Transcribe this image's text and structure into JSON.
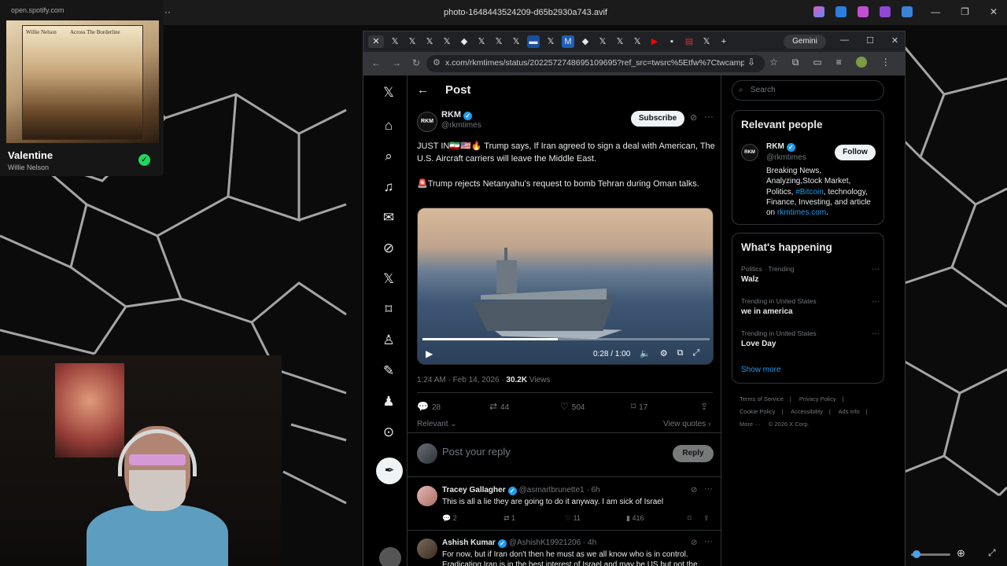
{
  "photo_viewer": {
    "title": "photo-1648443524209-d65b2930a743.avif",
    "controls": [
      "—",
      "❐",
      "✕"
    ]
  },
  "spotify": {
    "url": "open.spotify.com",
    "album_artist": "Willie Nelson",
    "album_name": "Across The Borderline",
    "song_title": "Valentine",
    "song_artist": "Willie Nelson"
  },
  "browser": {
    "gemini_label": "Gemini",
    "url": "x.com/rkmtimes/status/2022572748695109695?ref_src=twsrc%5Etfw%7Ctwcamp%5Etweetembed"
  },
  "x": {
    "header_title": "Post",
    "author": {
      "name": "RKM",
      "handle": "@rkmtimes",
      "avatar_text": "RKM"
    },
    "subscribe_label": "Subscribe",
    "text1": "JUST IN🇮🇷🇺🇸🔥 Trump says, If Iran agreed to sign a deal with American, The U.S. Aircraft carriers will leave the Middle East.",
    "text2": "🚨Trump rejects Netanyahu's request to bomb Tehran during Oman talks.",
    "video": {
      "time": "0:28 / 1:00",
      "progress": 0.47
    },
    "meta_time": "1:24 AM · Feb 14, 2026 · ",
    "meta_views_count": "30.2K",
    "meta_views_label": " Views",
    "actions": {
      "replies": "28",
      "reposts": "44",
      "likes": "504",
      "bookmarks": "17"
    },
    "relevant_label": "Relevant ⌄",
    "view_quotes_label": "View quotes ›",
    "reply_placeholder": "Post your reply",
    "reply_button": "Reply",
    "replies": [
      {
        "name": "Tracey Gallagher",
        "handle": "@asmartbrunette1 · 6h",
        "text": "This is all a lie they are going to do it anyway. I am sick of Israel",
        "replies": "2",
        "reposts": "1",
        "likes": "11",
        "views": "416"
      },
      {
        "name": "Ashish Kumar",
        "handle": "@AshishK19921206 · 4h",
        "text": "For now, but if Iran don't then he must as we all know who is in control. Eradicating Iran is in the best interest of Israel and may be US but not the",
        "replies": "",
        "reposts": "",
        "likes": "",
        "views": ""
      }
    ],
    "sidebar": {
      "search_placeholder": "Search",
      "relevant_title": "Relevant people",
      "rp_name": "RKM",
      "rp_handle": "@rkmtimes",
      "follow_label": "Follow",
      "bio_1": "Breaking News, Analyzing,Stock Market, Politics, ",
      "bio_link1": "#Bitcoin",
      "bio_2": ", technology, Finance, Investing, and article on ",
      "bio_link2": "rkmtimes.com",
      "bio_3": ".",
      "trends_title": "What's happening",
      "trends": [
        {
          "context": "Politics · Trending",
          "name": "Walz"
        },
        {
          "context": "Trending in United States",
          "name": "we in america"
        },
        {
          "context": "Trending in United States",
          "name": "Love Day"
        }
      ],
      "show_more": "Show more",
      "footer": [
        "Terms of Service",
        "|",
        "Privacy Policy",
        "|",
        "Cookie Policy",
        "|",
        "Accessibility",
        "|",
        "Ads info",
        "|",
        "More ···",
        "© 2026 X Corp."
      ]
    }
  }
}
